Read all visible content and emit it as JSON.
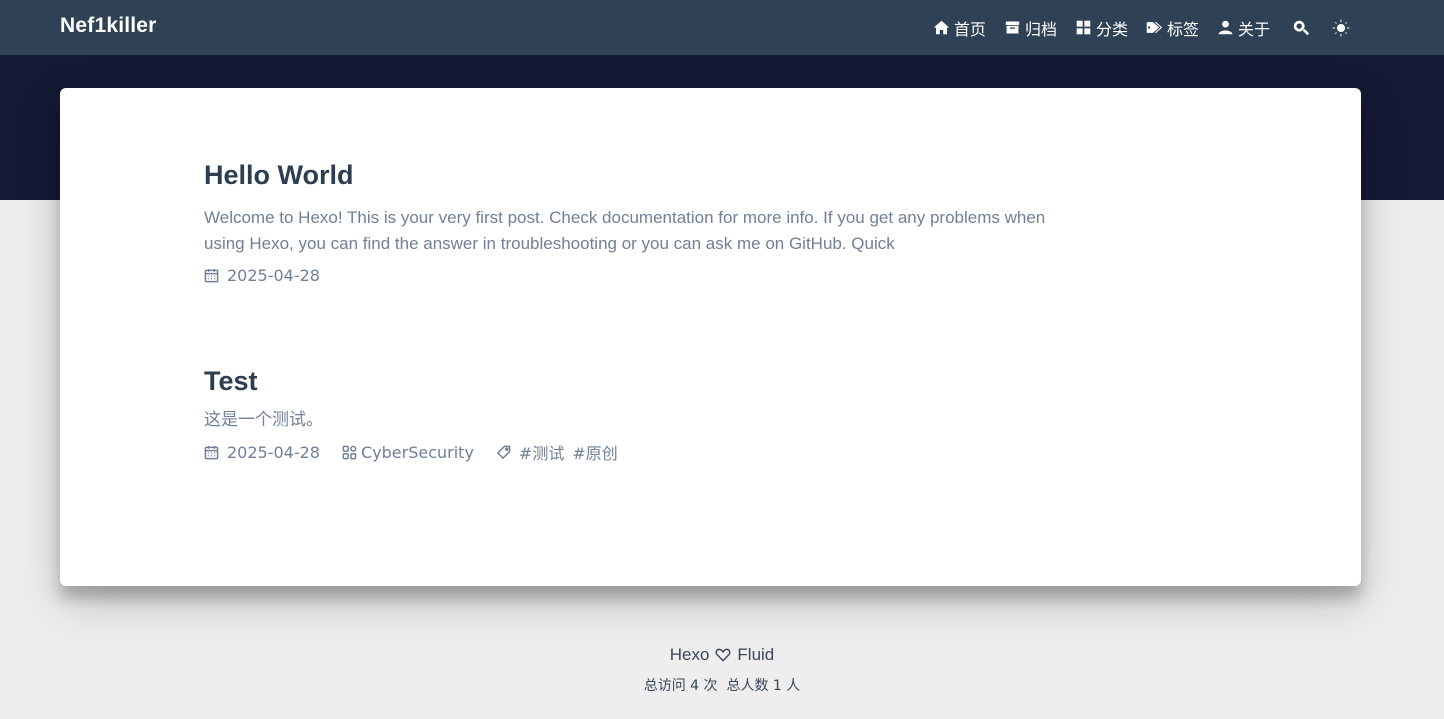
{
  "site": {
    "brand": "Nef1killer"
  },
  "nav": {
    "items": [
      {
        "label": "首页",
        "icon": "home-icon"
      },
      {
        "label": "归档",
        "icon": "archive-icon"
      },
      {
        "label": "分类",
        "icon": "category-icon"
      },
      {
        "label": "标签",
        "icon": "tag-icon"
      },
      {
        "label": "关于",
        "icon": "user-icon"
      }
    ],
    "search_icon": "search-icon",
    "theme_icon": "sun-icon"
  },
  "posts": [
    {
      "title": "Hello World",
      "excerpt_line1": "Welcome to Hexo! This is your very first post. Check documentation for more info. If you get any problems when",
      "excerpt_line2": "using Hexo, you can find the answer in troubleshooting or you can ask me on GitHub. Quick",
      "date": "2025-04-28"
    },
    {
      "title": "Test",
      "excerpt_line1": "这是一个测试。",
      "date": "2025-04-28",
      "category": "CyberSecurity",
      "tags": [
        "#测试",
        "#原创"
      ]
    }
  ],
  "footer": {
    "hexo": "Hexo",
    "fluid": "Fluid",
    "stats": "总访问 4 次  总人数 1 人"
  },
  "colors": {
    "navbar": "#2f4154",
    "banner": "#151a35",
    "background": "#eeeeee",
    "card": "#ffffff",
    "title": "#2c3e50",
    "muted": "#718096"
  }
}
